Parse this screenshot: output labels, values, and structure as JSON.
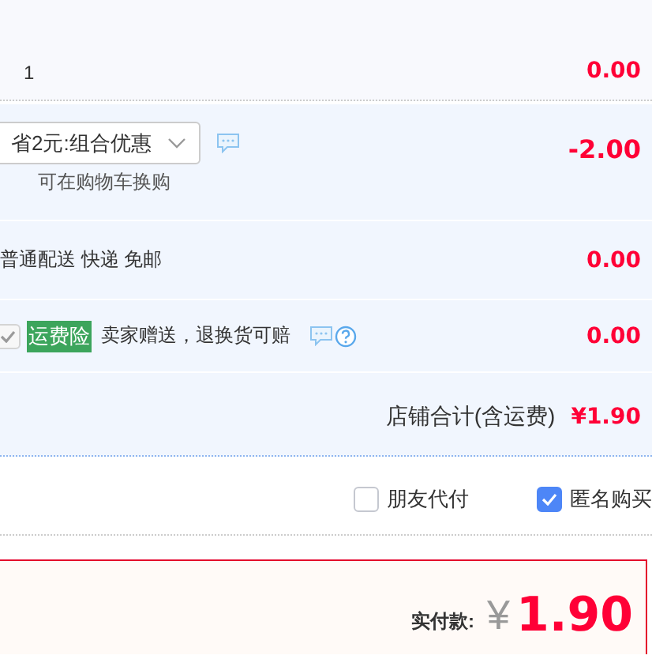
{
  "item_row": {
    "quantity": "1",
    "amount": "0.00"
  },
  "promotion": {
    "value": "省2元:组合优惠",
    "note": "可在购物车换购",
    "amount": "-2.00"
  },
  "shipping": {
    "label": "普通配送 快递 免邮",
    "amount": "0.00"
  },
  "insurance": {
    "checked": true,
    "disabled": true,
    "badge": "运费险",
    "label": "卖家赠送，退换货可赔",
    "amount": "0.00"
  },
  "shop_total": {
    "label": "店铺合计(含运费)",
    "amount": "¥1.90"
  },
  "options": [
    {
      "label": "朋友代付",
      "checked": false
    },
    {
      "label": "匿名购买",
      "checked": true
    }
  ],
  "payment": {
    "label": "实付款:",
    "currency": "¥",
    "amount": "1.90"
  }
}
